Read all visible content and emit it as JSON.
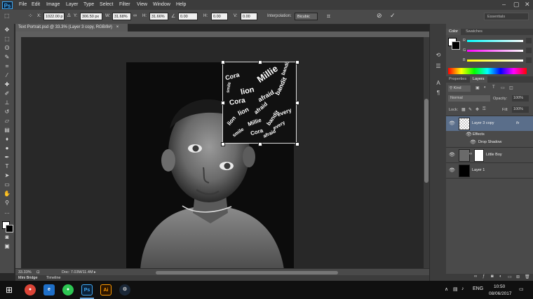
{
  "app": {
    "logo": "Ps"
  },
  "menubar": {
    "items": [
      "File",
      "Edit",
      "Image",
      "Layer",
      "Type",
      "Select",
      "Filter",
      "View",
      "Window",
      "Help"
    ]
  },
  "options": {
    "x_label": "X:",
    "x_value": "1022.00 p",
    "y_value": "306.50 px",
    "w_label": "W:",
    "w_value": "31.68%",
    "h_label": "H:",
    "h_value": "31.66%",
    "angle_value": "0.00",
    "hskew_label": "H:",
    "hskew_value": "0.00",
    "vskew_label": "V:",
    "vskew_value": "0.00",
    "interp_label": "Interpolation:",
    "interp_value": "Bicubic",
    "workspace": "Essentials"
  },
  "document": {
    "tab_title": "Text Portrait.psd @ 33.3% (Layer 3 copy, RGB/8#)",
    "zoom": "33.33%",
    "doc_info": "Doc: 7.03M/11.4M"
  },
  "word_art": [
    "Cora",
    "lion",
    "Millie",
    "bandit",
    "afraid",
    "every",
    "smile",
    "Cora",
    "lion",
    "afraid",
    "bandit",
    "Millie",
    "every",
    "lion",
    "Cora",
    "bandit",
    "smile",
    "afraid"
  ],
  "bottom_tabs": [
    "Mini Bridge",
    "Timeline"
  ],
  "color_panel": {
    "tabs": [
      "Color",
      "Swatches"
    ],
    "r_label": "R",
    "g_label": "G",
    "b_label": "B"
  },
  "layers_panel": {
    "top_tabs": [
      "Properties",
      "Layers"
    ],
    "kind_label": "Kind",
    "blend_mode": "Normal",
    "opacity_label": "Opacity:",
    "opacity_value": "100%",
    "lock_label": "Lock:",
    "fill_label": "Fill:",
    "fill_value": "100%",
    "layers": [
      {
        "name": "Layer 3 copy",
        "fx": "fx"
      },
      {
        "name": "Effects"
      },
      {
        "name": "Drop Shadow"
      },
      {
        "name": "Little Boy"
      },
      {
        "name": "Layer 1"
      }
    ]
  },
  "taskbar": {
    "time": "10:50",
    "date": "08/06/2017",
    "lang": "ENG",
    "apps": [
      "Ps",
      "Ai"
    ]
  },
  "colors": {
    "accent": "#5a6e8a",
    "ps_blue": "#3fa9f5"
  }
}
